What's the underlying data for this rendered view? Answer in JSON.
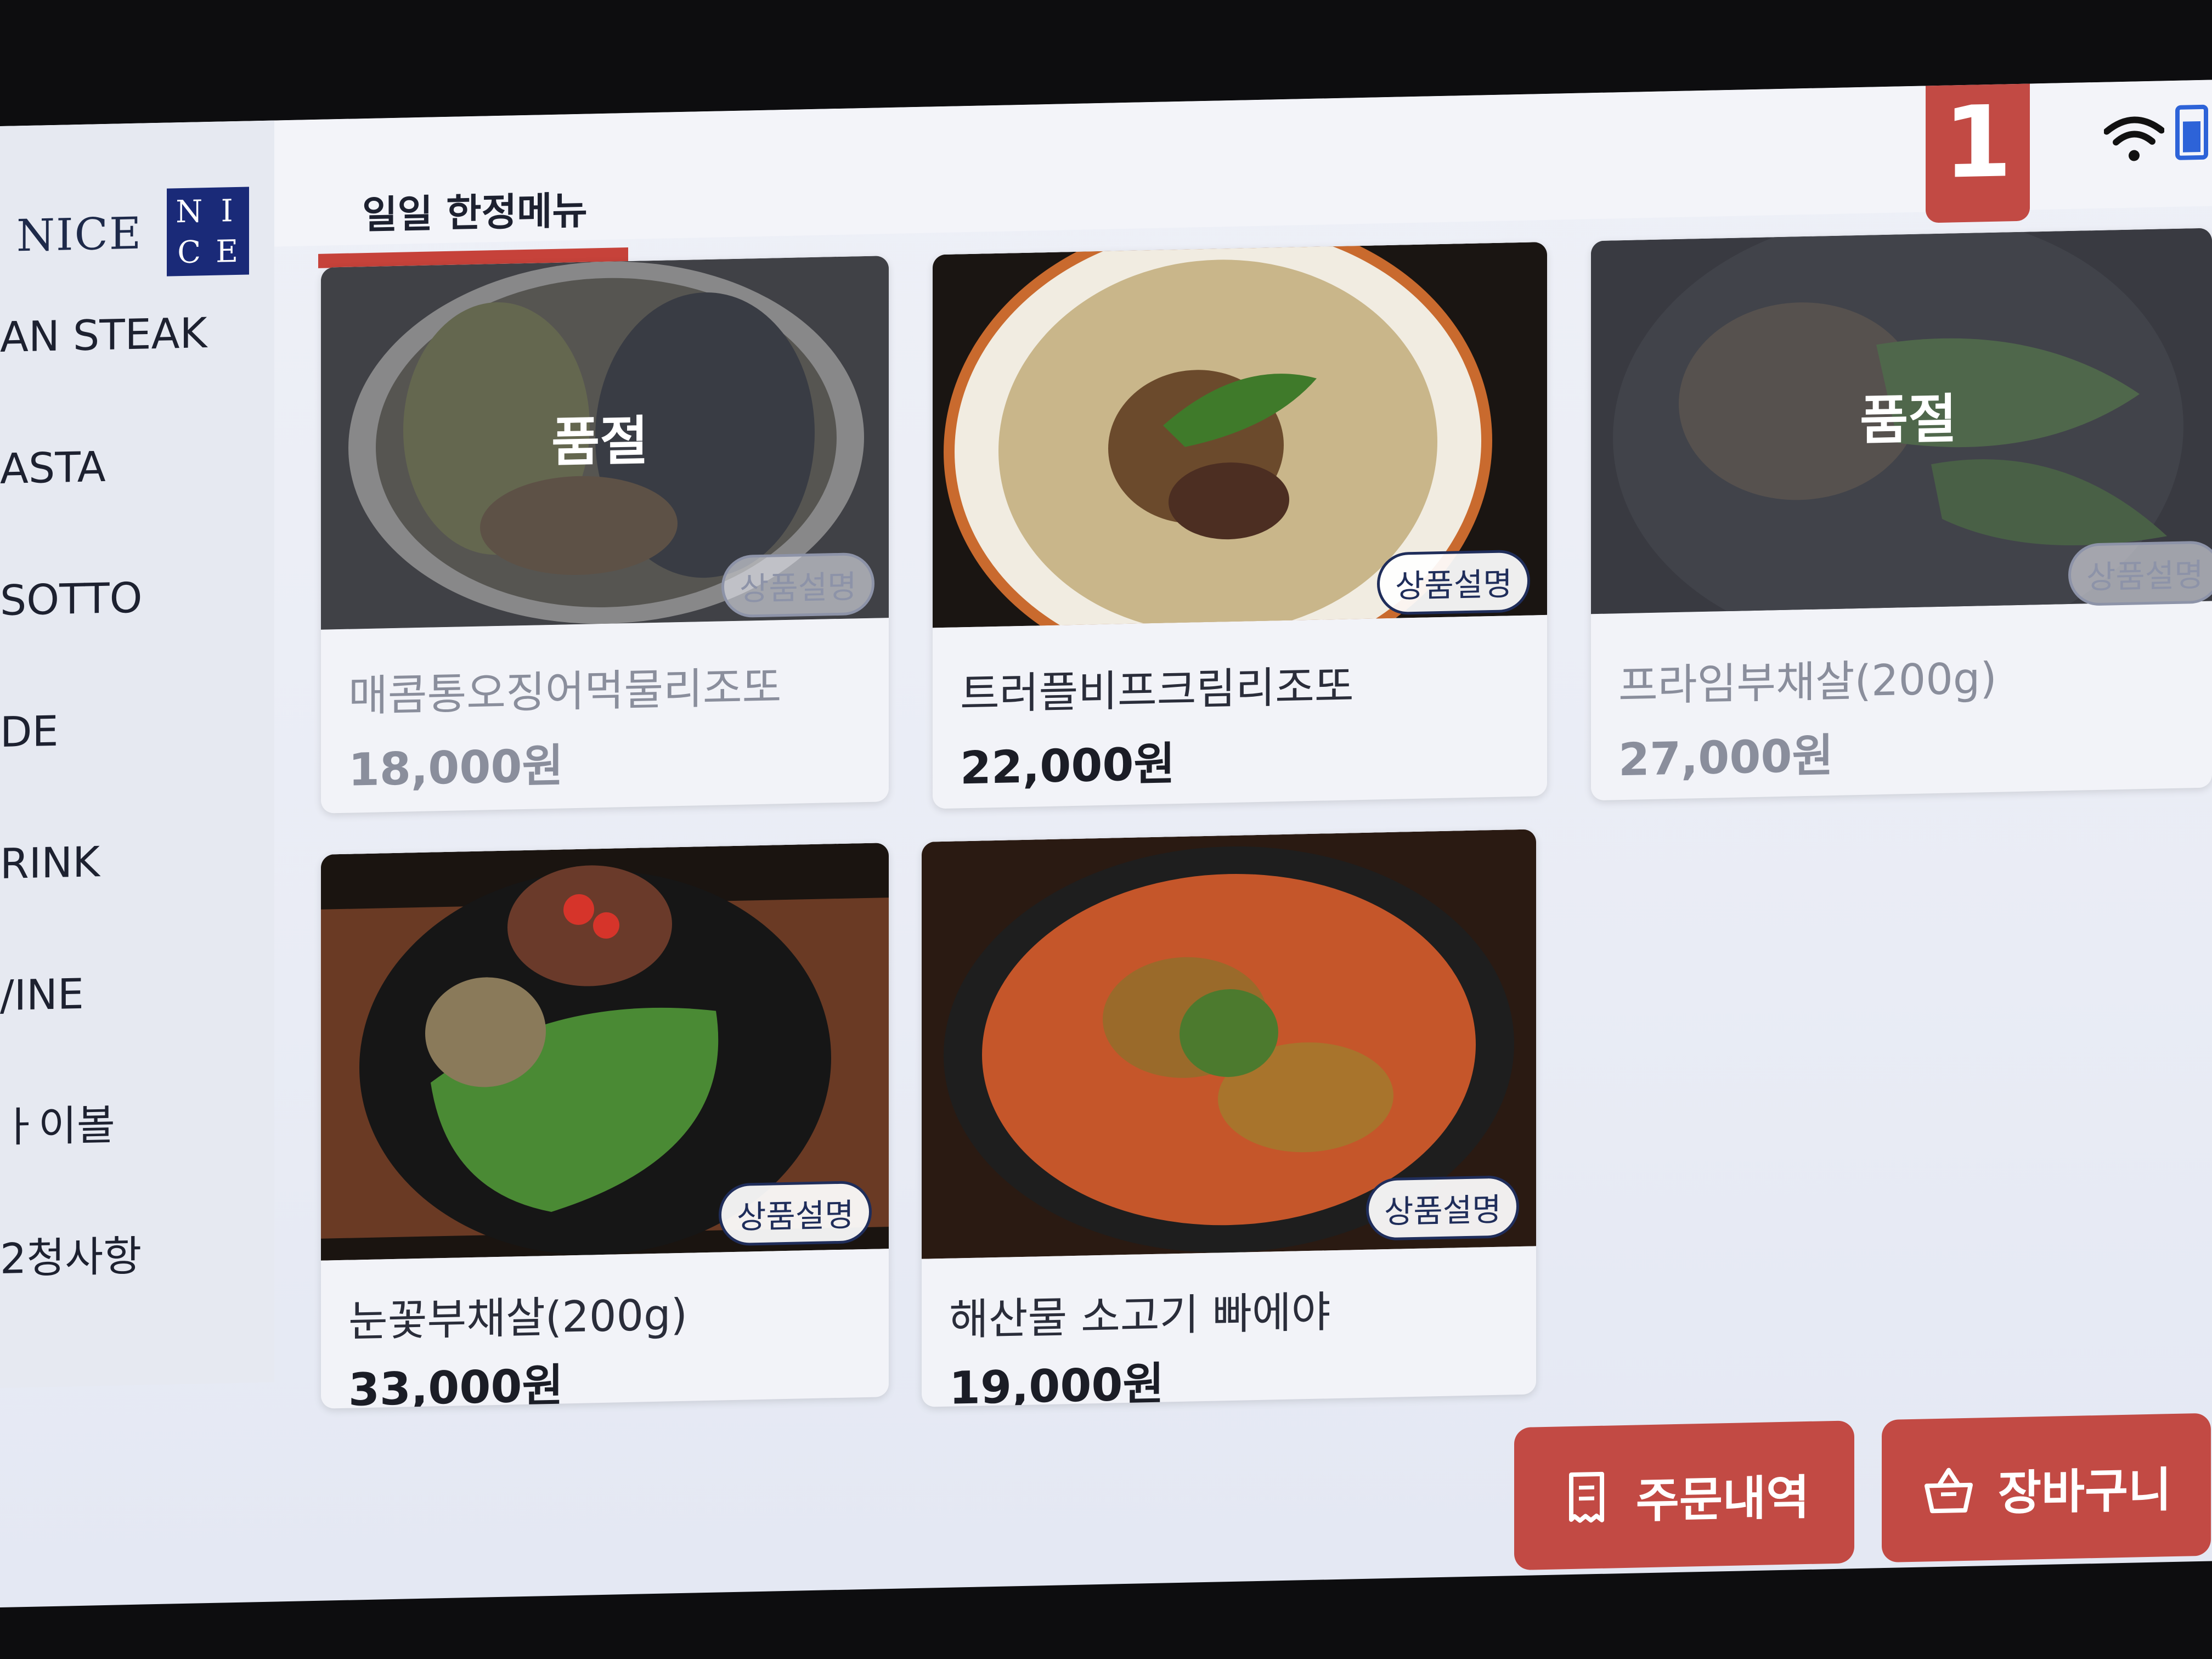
{
  "brand": {
    "name": "NICE",
    "logo_letters": [
      "N",
      "I",
      "C",
      "E"
    ]
  },
  "sidebar": {
    "items": [
      {
        "label": "AN STEAK"
      },
      {
        "label": "ASTA"
      },
      {
        "label": "SOTTO"
      },
      {
        "label": "DE"
      },
      {
        "label": "RINK"
      },
      {
        "label": "/INE"
      },
      {
        "label": "ㅏ이볼"
      },
      {
        "label": "2청사항"
      }
    ]
  },
  "tab": {
    "title": "일일 한정메뉴"
  },
  "status": {
    "order_number": "1",
    "wifi_icon": "wifi-icon",
    "battery_icon": "battery-icon"
  },
  "menu": {
    "sold_out_label": "품절",
    "desc_label": "상품설명",
    "items": [
      {
        "name": "매콤통오징어먹물리조또",
        "price": "18,000원",
        "sold_out": true
      },
      {
        "name": "트러플비프크림리조또",
        "price": "22,000원",
        "sold_out": false
      },
      {
        "name": "프라임부채살(200g)",
        "price": "27,000원",
        "sold_out": true
      },
      {
        "name": "눈꽃부채살(200g)",
        "price": "33,000원",
        "sold_out": false
      },
      {
        "name": "해산물 소고기 빠에야",
        "price": "19,000원",
        "sold_out": false
      }
    ]
  },
  "footer": {
    "order_history_label": "주문내역",
    "order_history_icon": "receipt-icon",
    "cart_label": "장바구니",
    "cart_icon": "basket-icon"
  },
  "colors": {
    "accent": "#c24a44",
    "brand_navy": "#1a2a78"
  }
}
